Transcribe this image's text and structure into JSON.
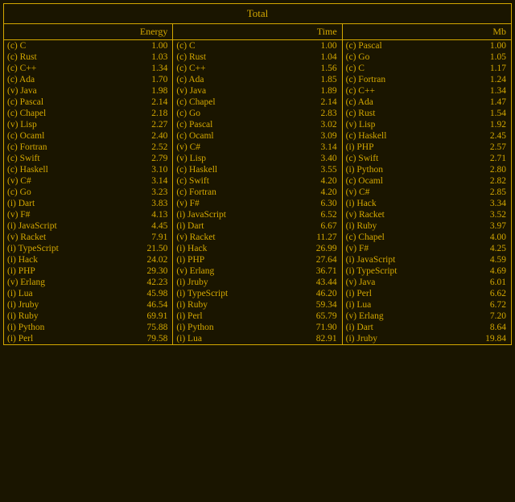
{
  "title": "Total",
  "energy": {
    "header": [
      "",
      "Energy"
    ],
    "rows": [
      [
        "(c) C",
        "1.00"
      ],
      [
        "(c) Rust",
        "1.03"
      ],
      [
        "(c) C++",
        "1.34"
      ],
      [
        "(c) Ada",
        "1.70"
      ],
      [
        "(v) Java",
        "1.98"
      ],
      [
        "(c) Pascal",
        "2.14"
      ],
      [
        "(c) Chapel",
        "2.18"
      ],
      [
        "(v) Lisp",
        "2.27"
      ],
      [
        "(c) Ocaml",
        "2.40"
      ],
      [
        "(c) Fortran",
        "2.52"
      ],
      [
        "(c) Swift",
        "2.79"
      ],
      [
        "(c) Haskell",
        "3.10"
      ],
      [
        "(v) C#",
        "3.14"
      ],
      [
        "(c) Go",
        "3.23"
      ],
      [
        "(i) Dart",
        "3.83"
      ],
      [
        "(v) F#",
        "4.13"
      ],
      [
        "(i) JavaScript",
        "4.45"
      ],
      [
        "(v) Racket",
        "7.91"
      ],
      [
        "(i) TypeScript",
        "21.50"
      ],
      [
        "(i) Hack",
        "24.02"
      ],
      [
        "(i) PHP",
        "29.30"
      ],
      [
        "(v) Erlang",
        "42.23"
      ],
      [
        "(i) Lua",
        "45.98"
      ],
      [
        "(i) Jruby",
        "46.54"
      ],
      [
        "(i) Ruby",
        "69.91"
      ],
      [
        "(i) Python",
        "75.88"
      ],
      [
        "(i) Perl",
        "79.58"
      ]
    ]
  },
  "time": {
    "header": [
      "",
      "Time"
    ],
    "rows": [
      [
        "(c) C",
        "1.00"
      ],
      [
        "(c) Rust",
        "1.04"
      ],
      [
        "(c) C++",
        "1.56"
      ],
      [
        "(c) Ada",
        "1.85"
      ],
      [
        "(v) Java",
        "1.89"
      ],
      [
        "(c) Chapel",
        "2.14"
      ],
      [
        "(c) Go",
        "2.83"
      ],
      [
        "(c) Pascal",
        "3.02"
      ],
      [
        "(c) Ocaml",
        "3.09"
      ],
      [
        "(v) C#",
        "3.14"
      ],
      [
        "(v) Lisp",
        "3.40"
      ],
      [
        "(c) Haskell",
        "3.55"
      ],
      [
        "(c) Swift",
        "4.20"
      ],
      [
        "(c) Fortran",
        "4.20"
      ],
      [
        "(v) F#",
        "6.30"
      ],
      [
        "(i) JavaScript",
        "6.52"
      ],
      [
        "(i) Dart",
        "6.67"
      ],
      [
        "(v) Racket",
        "11.27"
      ],
      [
        "(i) Hack",
        "26.99"
      ],
      [
        "(i) PHP",
        "27.64"
      ],
      [
        "(v) Erlang",
        "36.71"
      ],
      [
        "(i) Jruby",
        "43.44"
      ],
      [
        "(i) TypeScript",
        "46.20"
      ],
      [
        "(i) Ruby",
        "59.34"
      ],
      [
        "(i) Perl",
        "65.79"
      ],
      [
        "(i) Python",
        "71.90"
      ],
      [
        "(i) Lua",
        "82.91"
      ]
    ]
  },
  "mb": {
    "header": [
      "",
      "Mb"
    ],
    "rows": [
      [
        "(c) Pascal",
        "1.00"
      ],
      [
        "(c) Go",
        "1.05"
      ],
      [
        "(c) C",
        "1.17"
      ],
      [
        "(c) Fortran",
        "1.24"
      ],
      [
        "(c) C++",
        "1.34"
      ],
      [
        "(c) Ada",
        "1.47"
      ],
      [
        "(c) Rust",
        "1.54"
      ],
      [
        "(v) Lisp",
        "1.92"
      ],
      [
        "(c) Haskell",
        "2.45"
      ],
      [
        "(i) PHP",
        "2.57"
      ],
      [
        "(c) Swift",
        "2.71"
      ],
      [
        "(i) Python",
        "2.80"
      ],
      [
        "(c) Ocaml",
        "2.82"
      ],
      [
        "(v) C#",
        "2.85"
      ],
      [
        "(i) Hack",
        "3.34"
      ],
      [
        "(v) Racket",
        "3.52"
      ],
      [
        "(i) Ruby",
        "3.97"
      ],
      [
        "(c) Chapel",
        "4.00"
      ],
      [
        "(v) F#",
        "4.25"
      ],
      [
        "(i) JavaScript",
        "4.59"
      ],
      [
        "(i) TypeScript",
        "4.69"
      ],
      [
        "(v) Java",
        "6.01"
      ],
      [
        "(i) Perl",
        "6.62"
      ],
      [
        "(i) Lua",
        "6.72"
      ],
      [
        "(v) Erlang",
        "7.20"
      ],
      [
        "(i) Dart",
        "8.64"
      ],
      [
        "(i) Jruby",
        "19.84"
      ]
    ]
  }
}
